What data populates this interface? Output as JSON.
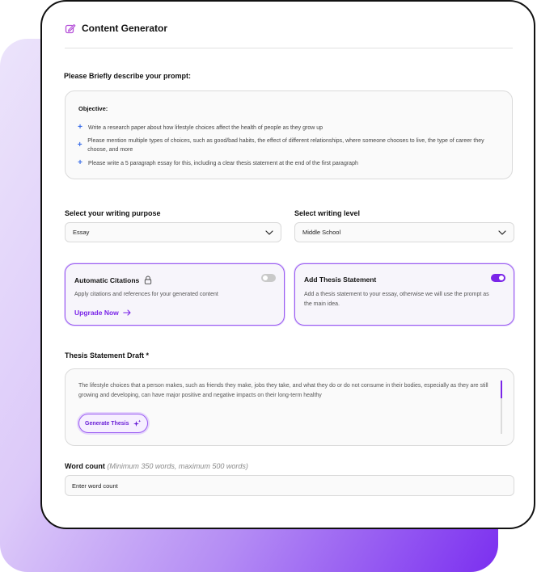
{
  "header": {
    "title": "Content Generator"
  },
  "prompt": {
    "label": "Please Briefly describe your prompt:",
    "objective_label": "Objective:",
    "bullets": [
      "Write a research paper about how lifestyle choices affect the health of people as they grow up",
      "Please mention multiple types of choices, such as good/bad habits, the effect of different relationships, where someone chooses to live, the type of career they choose, and more",
      "Please write a 5 paragraph essay for this, including a clear thesis statement at the end of the first paragraph"
    ]
  },
  "writing_purpose": {
    "label": "Select your writing purpose",
    "value": "Essay"
  },
  "writing_level": {
    "label": "Select writing level",
    "value": "Middle School"
  },
  "citations": {
    "title": "Automatic Citations",
    "description": "Apply citations and references for your generated content",
    "enabled": false,
    "upgrade_label": "Upgrade Now"
  },
  "thesis": {
    "title": "Add Thesis Statement",
    "description": "Add a thesis statement to your essay, otherwise we will use the prompt as the main idea.",
    "enabled": true
  },
  "thesis_draft": {
    "label": "Thesis Statement Draft *",
    "text": "The lifestyle choices that a person makes, such as friends they make, jobs they take, and what they do or do not consume in their bodies, especially as they are still growing and developing, can have major positive and negative impacts on their long-term healthy",
    "generate_label": "Generate Thesis"
  },
  "word_count": {
    "label": "Word count",
    "hint": "(Minimum 350 words, maximum 500 words)",
    "placeholder": "Enter word count"
  },
  "colors": {
    "accent": "#7a25e8",
    "bullet": "#3b6ee8"
  }
}
